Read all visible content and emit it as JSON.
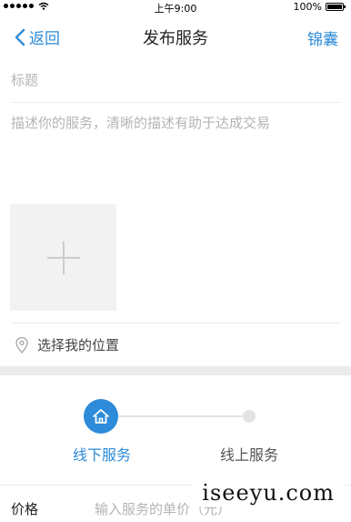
{
  "status_bar": {
    "time": "上午9:00",
    "battery": "100%",
    "battery_level": 1.0
  },
  "nav": {
    "back_label": "返回",
    "title": "发布服务",
    "right_label": "锦囊"
  },
  "form": {
    "title_placeholder": "标题",
    "description_placeholder": "描述你的服务，清晰的描述有助于达成交易",
    "location_label": "选择我的位置",
    "price_label": "价格",
    "price_placeholder": "输入服务的单价（元）"
  },
  "service_type": {
    "options": [
      {
        "label": "线下服务",
        "selected": true
      },
      {
        "label": "线上服务",
        "selected": false
      }
    ]
  },
  "watermark": "iseeyu.com",
  "colors": {
    "accent": "#2d8bd9",
    "placeholder": "#b4b4b4",
    "band": "#ebebeb"
  },
  "icons": [
    "signal-dots-icon",
    "wifi-icon",
    "battery-icon",
    "back-chevron-icon",
    "add-plus-icon",
    "location-pin-icon",
    "home-icon"
  ]
}
